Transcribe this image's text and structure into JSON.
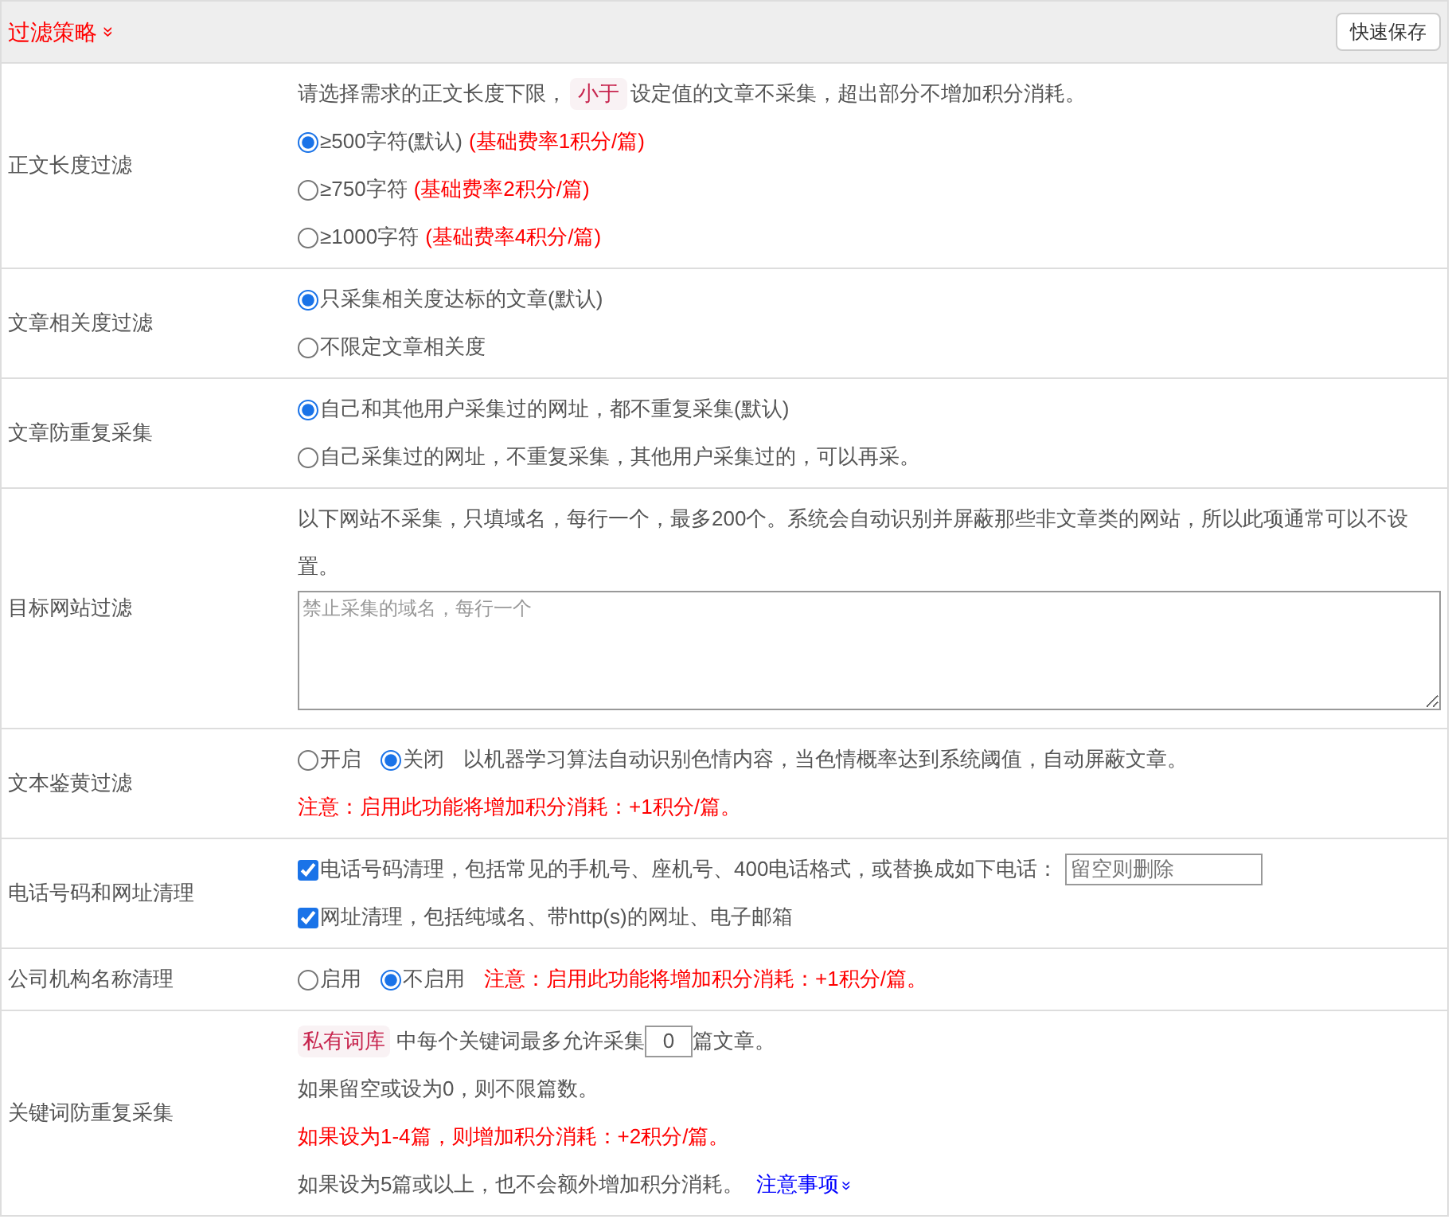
{
  "header": {
    "title": "过滤策略",
    "expand_icon": "»",
    "save_button": "快速保存"
  },
  "sections": [
    {
      "label": "正文长度过滤",
      "items": [
        {
          "kind": "tagged_text",
          "before": "请选择需求的正文长度下限，",
          "tag": "小于",
          "after": "设定值的文章不采集，超出部分不增加积分消耗。"
        },
        {
          "kind": "radio",
          "label": "≥500字符(默认)",
          "extra": "(基础费率1积分/篇)",
          "selected": true
        },
        {
          "kind": "radio",
          "label": "≥750字符",
          "extra": "(基础费率2积分/篇)",
          "selected": false
        },
        {
          "kind": "radio",
          "label": "≥1000字符",
          "extra": "(基础费率4积分/篇)",
          "selected": false
        }
      ]
    },
    {
      "label": "文章相关度过滤",
      "items": [
        {
          "kind": "radio",
          "label": "只采集相关度达标的文章(默认)",
          "selected": true
        },
        {
          "kind": "radio",
          "label": "不限定文章相关度",
          "selected": false
        }
      ]
    },
    {
      "label": "文章防重复采集",
      "items": [
        {
          "kind": "radio",
          "label": "自己和其他用户采集过的网址，都不重复采集(默认)",
          "selected": true
        },
        {
          "kind": "radio",
          "label": "自己采集过的网址，不重复采集，其他用户采集过的，可以再采。",
          "selected": false
        }
      ]
    },
    {
      "label": "目标网站过滤",
      "items": [
        {
          "kind": "text",
          "text": "以下网站不采集，只填域名，每行一个，最多200个。系统会自动识别并屏蔽那些非文章类的网站，所以此项通常可以不设置。",
          "warning": false
        },
        {
          "kind": "textarea",
          "placeholder": "禁止采集的域名，每行一个"
        }
      ]
    },
    {
      "label": "文本鉴黄过滤",
      "items": [
        {
          "kind": "radio_row",
          "options": [
            {
              "label": "开启",
              "selected": false
            },
            {
              "label": "关闭",
              "selected": true
            }
          ],
          "note": "以机器学习算法自动识别色情内容，当色情概率达到系统阈值，自动屏蔽文章。",
          "warning": false
        },
        {
          "kind": "text",
          "text": "注意：启用此功能将增加积分消耗：+1积分/篇。",
          "warning": true
        }
      ]
    },
    {
      "label": "电话号码和网址清理",
      "items": [
        {
          "kind": "checkbox",
          "label": "电话号码清理，包括常见的手机号、座机号、400电话格式，或替换成如下电话：",
          "checked": true,
          "placeholder": "留空则删除"
        },
        {
          "kind": "checkbox",
          "label": "网址清理，包括纯域名、带http(s)的网址、电子邮箱",
          "checked": true
        }
      ]
    },
    {
      "label": "公司机构名称清理",
      "items": [
        {
          "kind": "radio_row",
          "options": [
            {
              "label": "启用",
              "selected": false
            },
            {
              "label": "不启用",
              "selected": true
            }
          ],
          "note": "注意：启用此功能将增加积分消耗：+1积分/篇。",
          "warning": true
        }
      ]
    },
    {
      "label": "关键词防重复采集",
      "items": [
        {
          "kind": "count_text",
          "tag": "私有词库",
          "before": "中每个关键词最多允许采集",
          "value": "0",
          "after": "篇文章。"
        },
        {
          "kind": "text",
          "text": "如果留空或设为0，则不限篇数。",
          "warning": false
        },
        {
          "kind": "text",
          "text": "如果设为1-4篇，则增加积分消耗：+2积分/篇。",
          "warning": true
        },
        {
          "kind": "text_link",
          "text": "如果设为5篇或以上，也不会额外增加积分消耗。",
          "link": "注意事项",
          "link_icon": "»"
        }
      ]
    }
  ]
}
